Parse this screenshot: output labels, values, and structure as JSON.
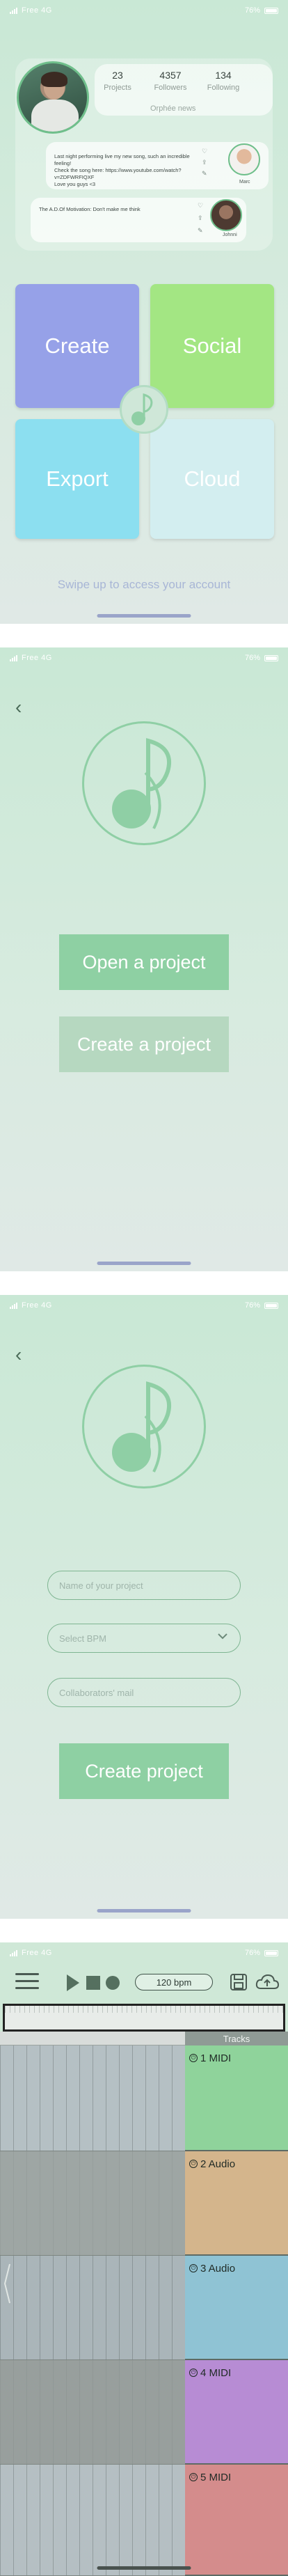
{
  "status": {
    "carrier": "Free 4G",
    "battery": "76%"
  },
  "dashboard": {
    "stats": [
      {
        "value": "23",
        "label": "Projects"
      },
      {
        "value": "4357",
        "label": "Followers"
      },
      {
        "value": "134",
        "label": "Following"
      }
    ],
    "tagline": "Orphée news",
    "posts": [
      {
        "lines": [
          "Last night performing live my new song, such an incredible feeling!",
          "Check the song here: https://www.youtube.com/watch?",
          "v=ZDFWRFIQXF",
          "Love you guys <3"
        ],
        "author": "Marc",
        "icons": [
          "heart-icon",
          "share-icon",
          "comment-icon"
        ]
      },
      {
        "lines": [
          "The A.D.Of Motivation: Don't make me think"
        ],
        "author": "Johnni",
        "icons": [
          "heart-icon",
          "share-icon",
          "comment-icon"
        ]
      }
    ],
    "tiles": [
      "Create",
      "Social",
      "Export",
      "Cloud"
    ],
    "swipe_hint": "Swipe up to access your account"
  },
  "project_menu": {
    "open_label": "Open a project",
    "create_label": "Create a project"
  },
  "create_form": {
    "name_placeholder": "Name of your project",
    "bpm_placeholder": "Select BPM",
    "mail_placeholder": "Collaborators' mail",
    "submit_label": "Create project"
  },
  "daw": {
    "bpm": "120 bpm",
    "tracks_header": "Tracks",
    "tracks": [
      {
        "name": "1 MIDI",
        "color": "#8fd39b"
      },
      {
        "name": "2 Audio",
        "color": "#d4b58c"
      },
      {
        "name": "3 Audio",
        "color": "#8fc3d4"
      },
      {
        "name": "4 MIDI",
        "color": "#b78cd4"
      },
      {
        "name": "5 MIDI",
        "color": "#d48c8c"
      }
    ]
  },
  "colors": {
    "accent_green": "#8ed0a3",
    "create_tile": "#96a1e8",
    "social_tile": "#a3e683",
    "export_tile": "#8cdff0",
    "cloud_tile": "#d3eef0"
  }
}
